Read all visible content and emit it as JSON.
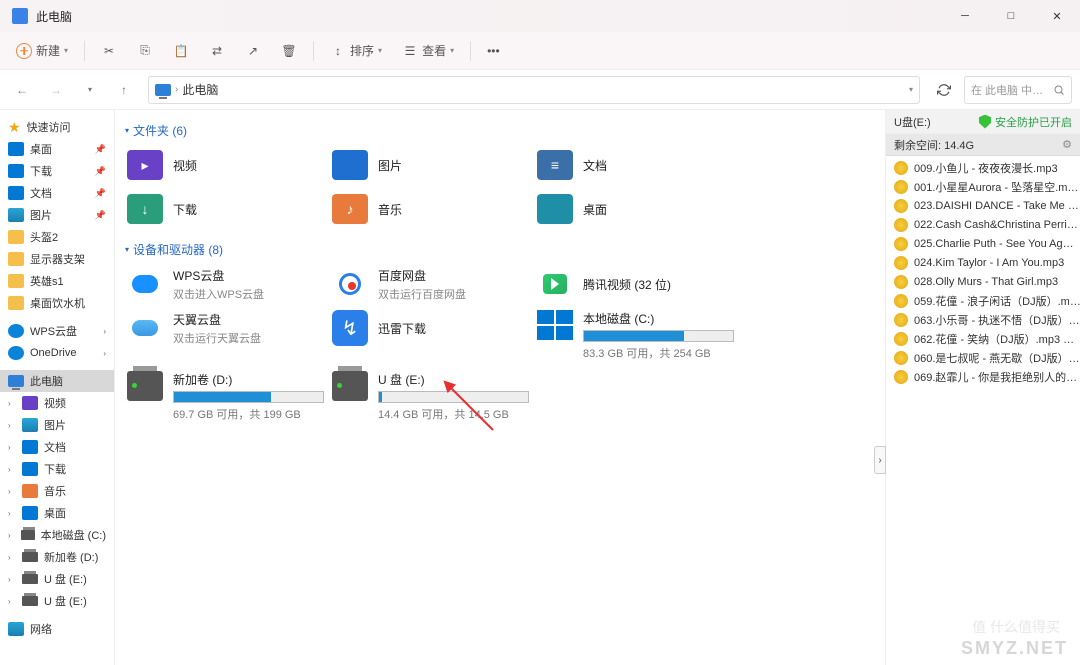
{
  "titlebar": {
    "title": "此电脑"
  },
  "toolbar": {
    "new_label": "新建",
    "sort_label": "排序",
    "view_label": "查看"
  },
  "addressbar": {
    "location": "此电脑",
    "search_placeholder": "在 此电脑 中…"
  },
  "sidebar": {
    "quick_access": "快速访问",
    "pinned": [
      {
        "label": "桌面",
        "color": "fld-blue"
      },
      {
        "label": "下载",
        "color": "fld-blue"
      },
      {
        "label": "文档",
        "color": "fld-blue"
      },
      {
        "label": "图片",
        "color": "fld-teal"
      }
    ],
    "recent": [
      {
        "label": "头盔2"
      },
      {
        "label": "显示器支架"
      },
      {
        "label": "英雄s1"
      },
      {
        "label": "桌面饮水机"
      }
    ],
    "clouds": [
      {
        "label": "WPS云盘"
      },
      {
        "label": "OneDrive"
      }
    ],
    "thispc": "此电脑",
    "pc_children": [
      {
        "label": "视频",
        "ico": "ico-video"
      },
      {
        "label": "图片",
        "ico": "fld-teal"
      },
      {
        "label": "文档",
        "ico": "fld-blue"
      },
      {
        "label": "下载",
        "ico": "fld-blue"
      },
      {
        "label": "音乐",
        "ico": "ico-music"
      },
      {
        "label": "桌面",
        "ico": "fld-blue"
      }
    ],
    "drives": [
      {
        "label": "本地磁盘 (C:)"
      },
      {
        "label": "新加卷 (D:)"
      },
      {
        "label": "U 盘 (E:)"
      },
      {
        "label": "U 盘 (E:)"
      }
    ],
    "network": "网络"
  },
  "content": {
    "folders_header": "文件夹 (6)",
    "folders": [
      {
        "name": "视频",
        "ico": "ico-video",
        "glyph": "▸"
      },
      {
        "name": "图片",
        "ico": "ico-pic",
        "glyph": ""
      },
      {
        "name": "文档",
        "ico": "ico-doc",
        "glyph": "≡"
      },
      {
        "name": "下载",
        "ico": "ico-down",
        "glyph": "↓"
      },
      {
        "name": "音乐",
        "ico": "ico-music",
        "glyph": "♪"
      },
      {
        "name": "桌面",
        "ico": "ico-desk",
        "glyph": ""
      }
    ],
    "drives_header": "设备和驱动器 (8)",
    "apps": [
      {
        "name": "WPS云盘",
        "sub": "双击进入WPS云盘",
        "type": "wps"
      },
      {
        "name": "百度网盘",
        "sub": "双击运行百度网盘",
        "type": "baidu"
      },
      {
        "name": "腾讯视频 (32 位)",
        "sub": "",
        "type": "tencent"
      },
      {
        "name": "天翼云盘",
        "sub": "双击运行天翼云盘",
        "type": "tianyi"
      },
      {
        "name": "迅雷下载",
        "sub": "",
        "type": "xunlei"
      }
    ],
    "local_c": {
      "name": "本地磁盘 (C:)",
      "stat": "83.3 GB 可用，共 254 GB",
      "fill": 67
    },
    "drive_d": {
      "name": "新加卷 (D:)",
      "stat": "69.7 GB 可用，共 199 GB",
      "fill": 65
    },
    "drive_e": {
      "name": "U 盘 (E:)",
      "stat": "14.4 GB 可用，共 14.5 GB",
      "fill": 2
    }
  },
  "rightpanel": {
    "title": "U盘(E:)",
    "shield": "安全防护已开启",
    "space_label": "剩余空间: 14.4G",
    "files": [
      "009.小鱼儿 - 夜夜夜漫长.mp3",
      "001.小星星Aurora - 坠落星空.m…",
      "023.DAISHI DANCE - Take Me …",
      "022.Cash Cash&Christina Perri…",
      "025.Charlie Puth - See You Ag…",
      "024.Kim Taylor - I Am You.mp3",
      "028.Olly Murs - That Girl.mp3",
      "059.花僮 - 浪子闲话（DJ版）.m…",
      "063.小乐哥 - 执迷不悟（DJ版）…",
      "062.花僮 - 笑纳（DJ版）.mp3 …",
      "060.是七叔呢 - 燕无歇（DJ版）…",
      "069.赵霏儿 - 你是我拒绝别人的…"
    ]
  },
  "watermark": {
    "brand": "SMYZ.NET",
    "tag": "值 什么值得买"
  }
}
